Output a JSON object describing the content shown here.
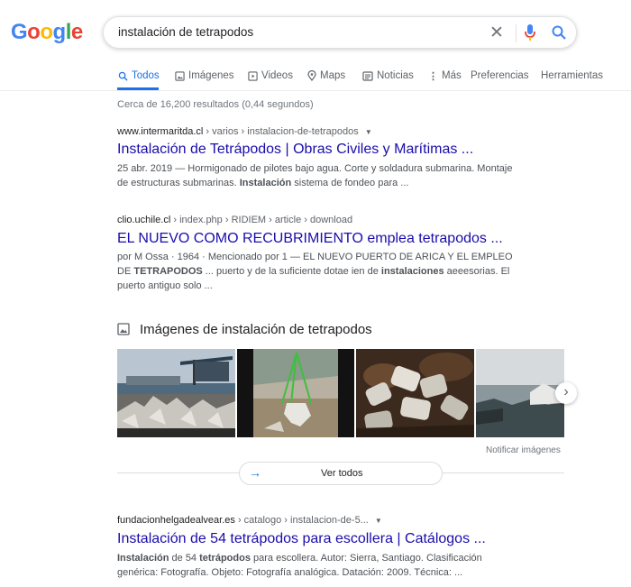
{
  "logo": {
    "letters": [
      "G",
      "o",
      "o",
      "g",
      "l",
      "e"
    ],
    "colors": [
      "#4285f4",
      "#ea4335",
      "#fbbc05",
      "#4285f4",
      "#34a853",
      "#ea4335"
    ]
  },
  "search": {
    "query": "instalación de tetrapodos"
  },
  "tabs": [
    {
      "label": "Todos",
      "icon": "search-icon",
      "active": true
    },
    {
      "label": "Imágenes",
      "icon": "image-icon"
    },
    {
      "label": "Videos",
      "icon": "video-icon"
    },
    {
      "label": "Maps",
      "icon": "map-pin-icon"
    },
    {
      "label": "Noticias",
      "icon": "news-icon"
    },
    {
      "label": "Más",
      "icon": "more-vert-icon"
    },
    {
      "label": "Preferencias"
    },
    {
      "label": "Herramientas"
    }
  ],
  "stats": "Cerca de 16,200 resultados (0,44 segundos)",
  "results": [
    {
      "domain": "www.intermaritda.cl",
      "path": " › varios › instalacion-de-tetrapodos",
      "title": "Instalación de Tetrápodos | Obras Civiles y Marítimas ...",
      "snippet_parts": [
        {
          "t": "25 abr. 2019 — Hormigonado de pilotes bajo agua. Corte y soldadura submarina. Montaje de estructuras submarinas. "
        },
        {
          "t": "Instalación",
          "b": true
        },
        {
          "t": " sistema de fondeo para ..."
        }
      ]
    },
    {
      "domain": "clio.uchile.cl",
      "path": " › index.php › RIDIEM › article › download",
      "title": "EL NUEVO COMO RECUBRIMIENTO emplea tetrapodos ...",
      "snippet_parts": [
        {
          "t": "por M Ossa · 1964 · Mencionado por 1 — EL NUEVO PUERTO DE ARICA Y EL EMPLEO DE "
        },
        {
          "t": "TETRAPODOS",
          "b": true
        },
        {
          "t": " ... puerto y de la suficiente dotae ien de "
        },
        {
          "t": "instalaciones",
          "b": true
        },
        {
          "t": " aeeesorias. El puerto antiguo solo ..."
        }
      ]
    },
    {
      "domain": "fundacionhelgadealvear.es",
      "path": " › catalogo › instalacion-de-5...",
      "title": "Instalación de 54 tetrápodos para escollera | Catálogos ...",
      "snippet_parts": [
        {
          "t": "Instalación",
          "b": true
        },
        {
          "t": " de 54 "
        },
        {
          "t": "tetrápodos",
          "b": true
        },
        {
          "t": " para escollera. Autor: Sierra, Santiago. Clasificación genérica: Fotografía. Objeto: Fotografía analógica. Datación: 2009. Técnica: ..."
        }
      ]
    }
  ],
  "images_block": {
    "heading": "Imágenes de instalación de tetrapodos",
    "report": "Notificar imágenes",
    "see_all": "Ver todos"
  },
  "colors": {
    "link": "#1a0dab",
    "accent": "#1a73e8"
  }
}
